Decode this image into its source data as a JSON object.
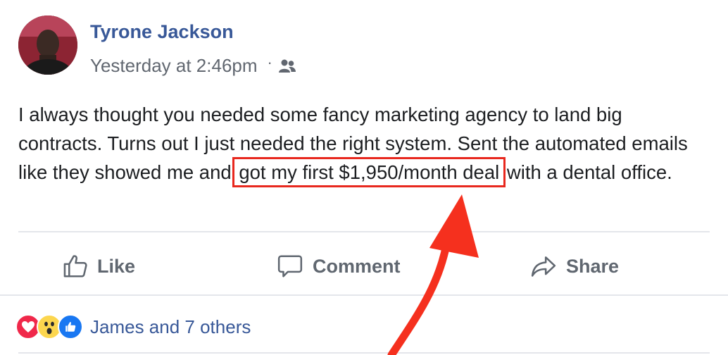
{
  "post": {
    "author": "Tyrone Jackson",
    "timestamp": "Yesterday at 2:46pm",
    "audience_icon": "friends-icon",
    "text_before": "I always thought you needed some fancy marketing agency to land big contracts. Turns out I just needed the right system. Sent the automated emails like they showed me and ",
    "text_highlight": "got my first $1,950/month deal",
    "text_after": " with a dental office."
  },
  "actions": {
    "like_label": "Like",
    "comment_label": "Comment",
    "share_label": "Share"
  },
  "reactions": {
    "icons": [
      "love-icon",
      "wow-icon",
      "like-icon"
    ],
    "summary": "James and 7 others"
  },
  "colors": {
    "link_blue": "#385898",
    "highlight_red": "#e8281e",
    "action_gray": "#606770"
  }
}
